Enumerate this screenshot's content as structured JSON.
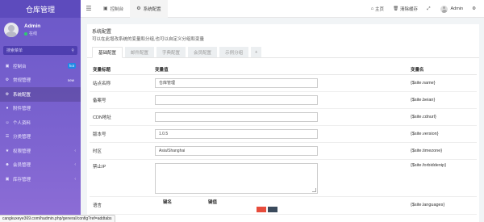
{
  "app": {
    "title": "仓库管理"
  },
  "user": {
    "name": "Admin",
    "status": "在线"
  },
  "search": {
    "placeholder": "搜索菜单"
  },
  "menu": [
    {
      "label": "控制台",
      "icon": "dashboard-icon",
      "badge": "hot"
    },
    {
      "label": "常规管理",
      "icon": "cogs-icon",
      "badge": "new"
    },
    {
      "label": "系统配置",
      "icon": "gear-icon",
      "active": true
    },
    {
      "label": "附件管理",
      "icon": "paperclip-icon"
    },
    {
      "label": "个人资料",
      "icon": "user-icon"
    },
    {
      "label": "分类管理",
      "icon": "list-icon"
    },
    {
      "label": "权限管理",
      "icon": "group-icon"
    },
    {
      "label": "会员管理",
      "icon": "users-icon"
    },
    {
      "label": "库存管理",
      "icon": "box-icon"
    }
  ],
  "topbar": {
    "tabs": [
      {
        "label": "控制台",
        "icon": "dashboard-icon"
      },
      {
        "label": "系统配置",
        "icon": "gear-icon"
      }
    ],
    "home": "主页",
    "clear_cache": "清除缓存",
    "username": "Admin"
  },
  "panel": {
    "title": "系统配置",
    "desc": "可以在此增改系统的变量和分组,也可以自定义分组和变量"
  },
  "config_tabs": [
    "基础配置",
    "邮件配置",
    "字典配置",
    "会员配置",
    "示例分组",
    "+"
  ],
  "table": {
    "headers": [
      "变量标题",
      "变量值",
      "变量名"
    ],
    "rows": [
      {
        "title": "站点名称",
        "value": "仓库管理",
        "var": "{$site.name}"
      },
      {
        "title": "备案号",
        "value": "",
        "var": "{$site.beian}"
      },
      {
        "title": "CDN地址",
        "value": "",
        "var": "{$site.cdnurl}"
      },
      {
        "title": "版本号",
        "value": "1.0.5",
        "var": "{$site.version}"
      },
      {
        "title": "时区",
        "value": "Asia/Shanghai",
        "var": "{$site.timezone}"
      },
      {
        "title": "禁止IP",
        "value": "",
        "var": "{$site.forbiddenip}"
      },
      {
        "title": "语言",
        "value": "",
        "var": "{$site.languages}"
      }
    ],
    "subheaders": [
      "键名",
      "键值"
    ]
  },
  "statusbar": {
    "url": "cangkuxeye369.com/hadmin.php/general/config?ref=addtabs"
  },
  "colors": {
    "sidebar": "#6b58c8",
    "accent": "#1e88e5",
    "danger": "#e74c3c"
  }
}
